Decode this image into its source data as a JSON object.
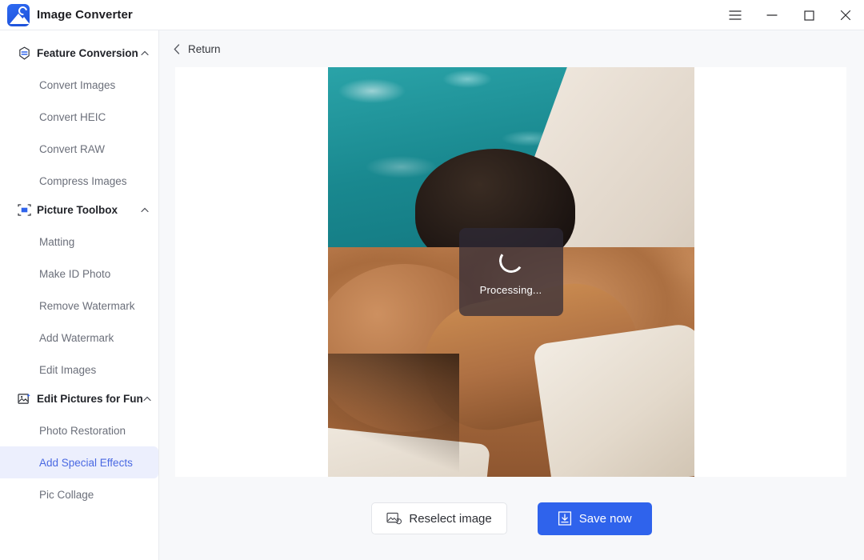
{
  "window": {
    "app_title": "Image Converter",
    "logo_icon": "image-converter-logo",
    "controls": {
      "menu_label": "menu-icon",
      "minimize_label": "minimize-icon",
      "maximize_label": "maximize-icon",
      "close_label": "close-icon"
    }
  },
  "sidebar": {
    "groups": [
      {
        "label": "Feature Conversion",
        "icon": "convert-hexagon-icon",
        "expanded": true,
        "chevron": "chevron-up-icon",
        "items": [
          {
            "label": "Convert Images",
            "active": false
          },
          {
            "label": "Convert HEIC",
            "active": false
          },
          {
            "label": "Convert RAW",
            "active": false
          },
          {
            "label": "Compress Images",
            "active": false
          }
        ]
      },
      {
        "label": "Picture Toolbox",
        "icon": "toolbox-frame-icon",
        "expanded": true,
        "chevron": "chevron-up-icon",
        "items": [
          {
            "label": "Matting",
            "active": false
          },
          {
            "label": "Make ID Photo",
            "active": false
          },
          {
            "label": "Remove Watermark",
            "active": false
          },
          {
            "label": "Add Watermark",
            "active": false
          },
          {
            "label": "Edit Images",
            "active": false
          }
        ]
      },
      {
        "label": "Edit Pictures for Fun",
        "icon": "picture-sparkle-icon",
        "expanded": true,
        "chevron": "chevron-up-icon",
        "items": [
          {
            "label": "Photo Restoration",
            "active": false
          },
          {
            "label": "Add Special Effects",
            "active": true
          },
          {
            "label": "Pic Collage",
            "active": false
          }
        ]
      }
    ]
  },
  "main": {
    "return": {
      "label": "Return",
      "icon": "chevron-left-icon"
    },
    "preview": {
      "image_alt": "man-resting-by-pool-photo",
      "overlay": {
        "status_text": "Processing...",
        "spinner": "loading-spinner"
      }
    },
    "actions": {
      "reselect": {
        "label": "Reselect image",
        "icon": "reselect-image-icon"
      },
      "save": {
        "label": "Save now",
        "icon": "download-save-icon"
      }
    }
  },
  "colors": {
    "accent": "#2f63ec",
    "active_item_text": "#4a69e2",
    "active_item_bg": "#eceffd",
    "main_bg": "#f7f8fa",
    "card_bg": "#ffffff",
    "overlay_bg": "rgba(46,42,56,0.72)"
  }
}
